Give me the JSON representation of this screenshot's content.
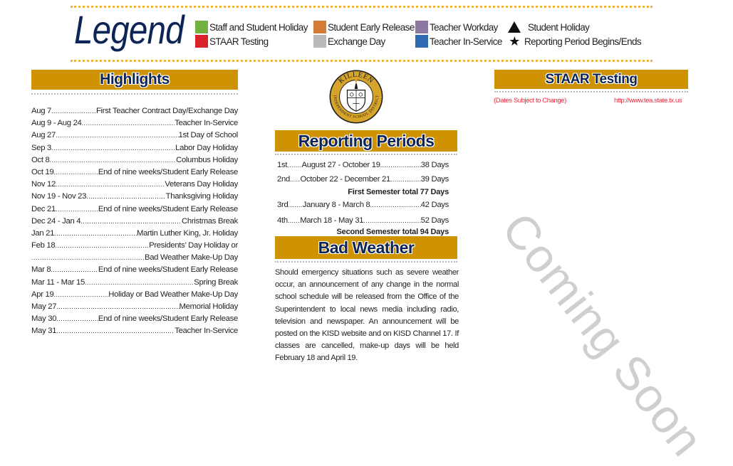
{
  "legend": {
    "title": "Legend",
    "items": [
      {
        "label": "Staff and Student Holiday",
        "color": "#72b13f",
        "type": "swatch"
      },
      {
        "label": "STAAR Testing",
        "color": "#d9232b",
        "type": "swatch"
      },
      {
        "label": "Student Early Release",
        "color": "#d27c36",
        "type": "swatch"
      },
      {
        "label": "Exchange Day",
        "color": "#b9babc",
        "type": "swatch"
      },
      {
        "label": "Teacher Workday",
        "color": "#8e77a0",
        "type": "swatch"
      },
      {
        "label": "Teacher In-Service",
        "color": "#3069b4",
        "type": "swatch"
      },
      {
        "label": "Student Holiday",
        "symbol": "triangle-icon",
        "type": "symbol"
      },
      {
        "label": "Reporting Period Begins/Ends",
        "symbol": "star-icon",
        "glyph": "★",
        "type": "symbol"
      }
    ]
  },
  "colors": {
    "section_bar": "#cf9200",
    "heading_text": "#0c2456",
    "accent_dots": "#f2b33d",
    "note_red": "#e8283a",
    "watermark": "#cfcfcf"
  },
  "highlights": {
    "title": "Highlights",
    "rows": [
      {
        "date": "Aug 7",
        "event": "First Teacher Contract Day/Exchange Day"
      },
      {
        "date": "Aug 9 - Aug 24",
        "event": "Teacher In-Service"
      },
      {
        "date": "Aug 27 ",
        "event": " 1st Day of School"
      },
      {
        "date": "Sep 3 ",
        "event": "Labor Day Holiday"
      },
      {
        "date": "Oct 8",
        "event": "Columbus Holiday"
      },
      {
        "date": "Oct 19 ",
        "event": "End of nine weeks/Student Early Release"
      },
      {
        "date": "Nov 12 ",
        "event": " Veterans Day Holiday"
      },
      {
        "date": "Nov 19 - Nov 23",
        "event": "Thanksgiving Holiday"
      },
      {
        "date": " Dec 21",
        "event": "End of nine weeks/Student Early Release"
      },
      {
        "date": "Dec 24 - Jan 4",
        "event": "Christmas Break"
      },
      {
        "date": "Jan 21",
        "event": "Martin Luther King, Jr. Holiday"
      },
      {
        "date": "Feb 18 ",
        "event": "Presidents’ Day Holiday or"
      },
      {
        "date": "",
        "event": " Bad Weather Make-Up Day"
      },
      {
        "date": "Mar 8 ",
        "event": "End of nine weeks/Student Early Release"
      },
      {
        "date": "Mar 11 - Mar 15 ",
        "event": "Spring Break"
      },
      {
        "date": "Apr 19 ",
        "event": "Holiday or Bad Weather Make-Up Day"
      },
      {
        "date": "May 27 ",
        "event": " Memorial Holiday"
      },
      {
        "date": "May 30",
        "event": "End of nine weeks/Student Early Release"
      },
      {
        "date": " May 31",
        "event": "Teacher In-Service"
      }
    ]
  },
  "seal": {
    "top_text": "KILLEEN",
    "ring_text": "INDEPENDENT SCHOOL DISTRICT"
  },
  "reporting_periods": {
    "title": "Reporting Periods",
    "periods": [
      {
        "label": "1st",
        "lead": ".......",
        "range": " August 27 - October 19 ",
        "days": "38 Days"
      },
      {
        "label": "2nd ",
        "lead": ".....",
        "range": " October 22 - December 21",
        "days": "39 Days"
      },
      {
        "label": "3rd",
        "lead": ".......",
        "range": " January 8 - March 8",
        "days": "42 Days"
      },
      {
        "label": "4th ",
        "lead": "......",
        "range": " March 18  - May 31 ",
        "days": "52 Days"
      }
    ],
    "first_semester_total": "First Semester total 77 Days",
    "second_semester_total": "Second Semester total 94 Days"
  },
  "bad_weather": {
    "title": "Bad Weather",
    "text": "Should emergency situations such as severe weather occur, an announcement of any change in the normal school schedule will be released from the Office of the Superintendent to local news media including radio, television and newspaper.  An announcement will be posted on the KISD website and on KISD Channel 17. If classes are cancelled, make-up days will be held February 18 and April 19."
  },
  "staar": {
    "title": "STAAR Testing",
    "note": "(Dates Subject to Change)",
    "link": "http://www.tea.state.tx.us",
    "watermark": "Coming Soon"
  }
}
